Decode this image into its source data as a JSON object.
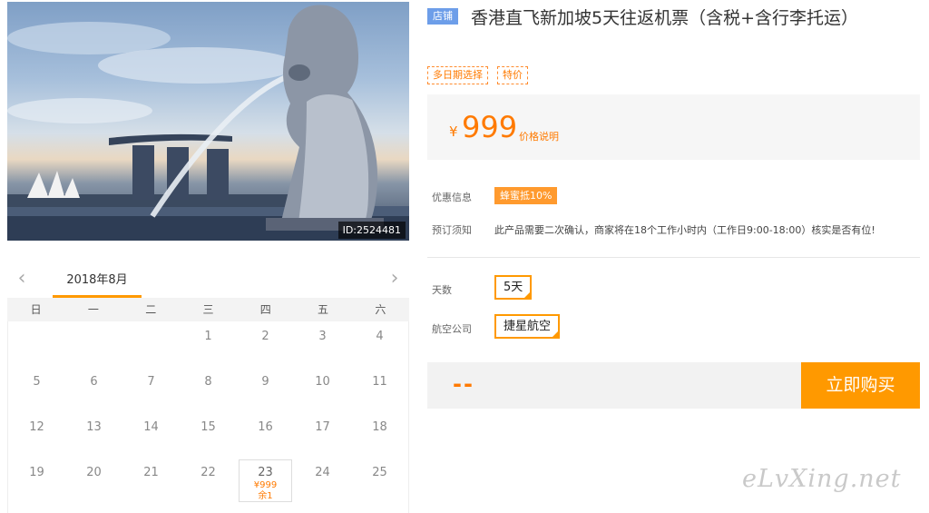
{
  "hero": {
    "image_id": "ID:2524481"
  },
  "calendar": {
    "month_label": "2018年8月",
    "prev_icon": "‹",
    "next_icon": "›",
    "weekdays": [
      "日",
      "一",
      "二",
      "三",
      "四",
      "五",
      "六"
    ],
    "weeks": [
      [
        "",
        "",
        "",
        "1",
        "2",
        "3",
        "4"
      ],
      [
        "5",
        "6",
        "7",
        "8",
        "9",
        "10",
        "11"
      ],
      [
        "12",
        "13",
        "14",
        "15",
        "16",
        "17",
        "18"
      ],
      [
        "19",
        "20",
        "21",
        "22",
        "23",
        "24",
        "25"
      ]
    ],
    "available_day": {
      "day": "23",
      "price": "¥999",
      "left": "余1"
    }
  },
  "product": {
    "store_tag": "店铺",
    "title": "香港直飞新加坡5天往返机票（含税+含行李托运）",
    "tags": [
      "多日期选择",
      "特价"
    ],
    "price_symbol": "¥",
    "price": "999",
    "price_note": "价格说明"
  },
  "promo": {
    "label": "优惠信息",
    "badge": "蜂蜜抵10%"
  },
  "notice": {
    "label": "预订须知",
    "text": "此产品需要二次确认，商家将在18个工作小时内（工作日9:00-18:00）核实是否有位!"
  },
  "options": {
    "days_label": "天数",
    "days_value": "5天",
    "airline_label": "航空公司",
    "airline_value": "捷星航空"
  },
  "purchase": {
    "total": "--",
    "buy_label": "立即购买"
  },
  "watermark": "eLvXing.net",
  "colors": {
    "accent": "#ff9900",
    "price": "#ff7a00",
    "store_tag": "#6d9ee9"
  }
}
